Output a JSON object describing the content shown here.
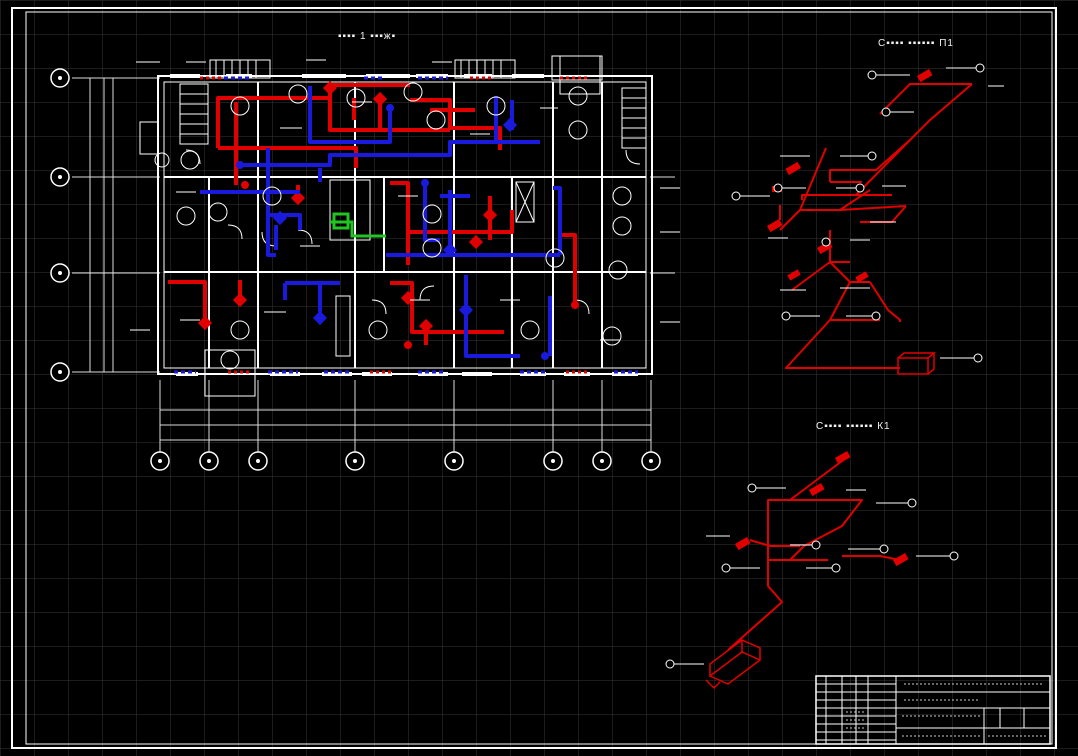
{
  "titles": {
    "plan": "▪▪▪▪ 1 ▪▪▪ж▪",
    "scheme_p1": "С▪▪▪▪ ▪▪▪▪▪▪ П1",
    "scheme_k1": "С▪▪▪▪ ▪▪▪▪▪▪ К1"
  },
  "colors": {
    "background": "#000000",
    "grid": "#3a3a3a",
    "frame": "#ffffff",
    "walls": "#ffffff",
    "supply_duct": "#e10000",
    "exhaust_duct": "#1a1adc",
    "fresh_air_duct": "#22c322"
  },
  "axes": {
    "rows": [
      "",
      "",
      "",
      ""
    ],
    "columns": [
      "",
      "",
      "",
      "",
      "",
      "",
      "",
      "",
      "",
      ""
    ]
  },
  "icons": [
    "grid-background",
    "drawing-frame",
    "floor-plan",
    "axonometric-scheme-p1",
    "axonometric-scheme-k1",
    "title-block"
  ]
}
